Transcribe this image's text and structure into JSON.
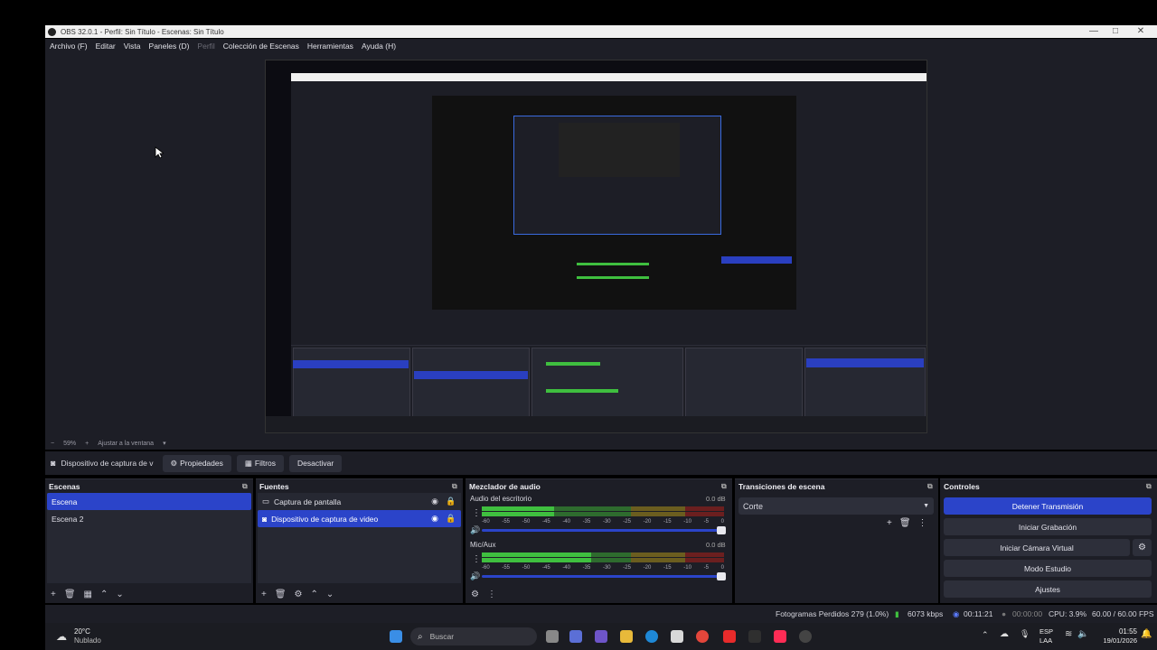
{
  "window": {
    "title": "OBS 32.0.1 - Perfil: Sin Título - Escenas: Sin Título",
    "controls": [
      "—",
      "□",
      "✕"
    ]
  },
  "menu": {
    "items": [
      {
        "label": "Archivo (F)",
        "disabled": false
      },
      {
        "label": "Editar",
        "disabled": false
      },
      {
        "label": "Vista",
        "disabled": false
      },
      {
        "label": "Paneles (D)",
        "disabled": false
      },
      {
        "label": "Perfil",
        "disabled": true
      },
      {
        "label": "Colección de Escenas",
        "disabled": false
      },
      {
        "label": "Herramientas",
        "disabled": false
      },
      {
        "label": "Ayuda (H)",
        "disabled": false
      }
    ]
  },
  "preview_status": {
    "zoom": "59%",
    "fit_label": "Ajustar a la ventana"
  },
  "source_toolbar": {
    "source_name": "Dispositivo de captura de v",
    "properties": "Propiedades",
    "filters": "Filtros",
    "deactivate": "Desactivar"
  },
  "scenes": {
    "title": "Escenas",
    "items": [
      "Escena",
      "Escena 2"
    ],
    "selected": 0
  },
  "sources": {
    "title": "Fuentes",
    "items": [
      {
        "label": "Captura de pantalla",
        "icon": "monitor-icon"
      },
      {
        "label": "Dispositivo de captura de video",
        "icon": "camera-icon"
      }
    ],
    "selected": 1
  },
  "mixer": {
    "title": "Mezclador de audio",
    "channels": [
      {
        "name": "Audio del escritorio",
        "db": "0.0 dB",
        "level": 0.3
      },
      {
        "name": "Mic/Aux",
        "db": "0.0 dB",
        "level": 0.45
      }
    ],
    "ticks": [
      "-60",
      "-55",
      "-50",
      "-45",
      "-40",
      "-35",
      "-30",
      "-25",
      "-20",
      "-15",
      "-10",
      "-5",
      "0"
    ]
  },
  "transitions": {
    "title": "Transiciones de escena",
    "selected": "Corte"
  },
  "controls": {
    "title": "Controles",
    "stop_stream": "Detener Transmisión",
    "start_recording": "Iniciar Grabación",
    "start_virtual_cam": "Iniciar Cámara Virtual",
    "studio_mode": "Modo Estudio",
    "settings": "Ajustes"
  },
  "statusbar": {
    "dropped_frames": "Fotogramas Perdidos 279 (1.0%)",
    "bitrate": "6073 kbps",
    "stream_time": "00:11:21",
    "rec_time": "00:00:00",
    "cpu": "CPU: 3.9%",
    "fps": "60.00 / 60.00 FPS"
  },
  "taskbar": {
    "weather_temp": "20°C",
    "weather_desc": "Nublado",
    "search_placeholder": "Buscar",
    "lang_top": "ESP",
    "lang_bottom": "LAA",
    "time": "01:55",
    "date": "19/01/2026"
  },
  "colors": {
    "accent": "#2b44c9",
    "panel_bg": "#1d1e26",
    "list_bg": "#262832"
  }
}
